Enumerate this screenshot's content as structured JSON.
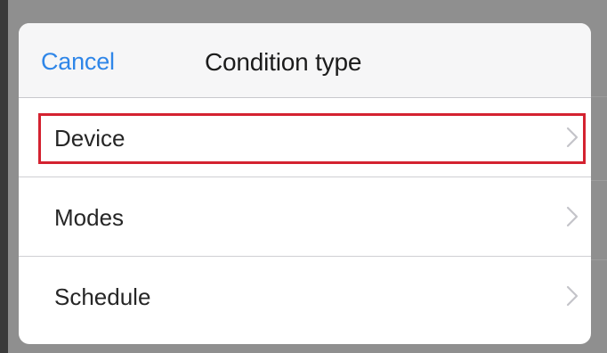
{
  "navbar": {
    "cancel_label": "Cancel",
    "title": "Condition type"
  },
  "rows": [
    {
      "label": "Device",
      "icon": "chevron-right-icon",
      "highlighted": true
    },
    {
      "label": "Modes",
      "icon": "chevron-right-icon",
      "highlighted": false
    },
    {
      "label": "Schedule",
      "icon": "chevron-right-icon",
      "highlighted": false
    }
  ],
  "colors": {
    "accent": "#2f86e8",
    "highlight_border": "#d42230",
    "backdrop": "#8f8f8f"
  }
}
